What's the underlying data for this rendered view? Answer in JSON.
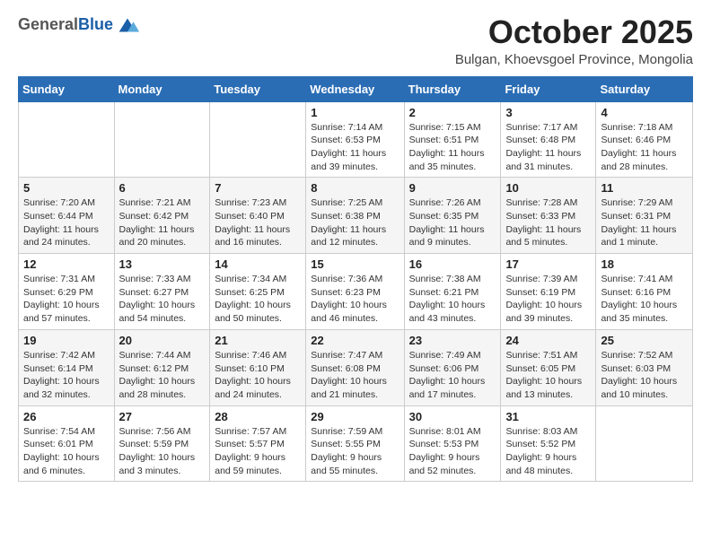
{
  "header": {
    "logo_general": "General",
    "logo_blue": "Blue",
    "month": "October 2025",
    "location": "Bulgan, Khoevsgoel Province, Mongolia"
  },
  "weekdays": [
    "Sunday",
    "Monday",
    "Tuesday",
    "Wednesday",
    "Thursday",
    "Friday",
    "Saturday"
  ],
  "weeks": [
    [
      {
        "day": "",
        "info": ""
      },
      {
        "day": "",
        "info": ""
      },
      {
        "day": "",
        "info": ""
      },
      {
        "day": "1",
        "info": "Sunrise: 7:14 AM\nSunset: 6:53 PM\nDaylight: 11 hours and 39 minutes."
      },
      {
        "day": "2",
        "info": "Sunrise: 7:15 AM\nSunset: 6:51 PM\nDaylight: 11 hours and 35 minutes."
      },
      {
        "day": "3",
        "info": "Sunrise: 7:17 AM\nSunset: 6:48 PM\nDaylight: 11 hours and 31 minutes."
      },
      {
        "day": "4",
        "info": "Sunrise: 7:18 AM\nSunset: 6:46 PM\nDaylight: 11 hours and 28 minutes."
      }
    ],
    [
      {
        "day": "5",
        "info": "Sunrise: 7:20 AM\nSunset: 6:44 PM\nDaylight: 11 hours and 24 minutes."
      },
      {
        "day": "6",
        "info": "Sunrise: 7:21 AM\nSunset: 6:42 PM\nDaylight: 11 hours and 20 minutes."
      },
      {
        "day": "7",
        "info": "Sunrise: 7:23 AM\nSunset: 6:40 PM\nDaylight: 11 hours and 16 minutes."
      },
      {
        "day": "8",
        "info": "Sunrise: 7:25 AM\nSunset: 6:38 PM\nDaylight: 11 hours and 12 minutes."
      },
      {
        "day": "9",
        "info": "Sunrise: 7:26 AM\nSunset: 6:35 PM\nDaylight: 11 hours and 9 minutes."
      },
      {
        "day": "10",
        "info": "Sunrise: 7:28 AM\nSunset: 6:33 PM\nDaylight: 11 hours and 5 minutes."
      },
      {
        "day": "11",
        "info": "Sunrise: 7:29 AM\nSunset: 6:31 PM\nDaylight: 11 hours and 1 minute."
      }
    ],
    [
      {
        "day": "12",
        "info": "Sunrise: 7:31 AM\nSunset: 6:29 PM\nDaylight: 10 hours and 57 minutes."
      },
      {
        "day": "13",
        "info": "Sunrise: 7:33 AM\nSunset: 6:27 PM\nDaylight: 10 hours and 54 minutes."
      },
      {
        "day": "14",
        "info": "Sunrise: 7:34 AM\nSunset: 6:25 PM\nDaylight: 10 hours and 50 minutes."
      },
      {
        "day": "15",
        "info": "Sunrise: 7:36 AM\nSunset: 6:23 PM\nDaylight: 10 hours and 46 minutes."
      },
      {
        "day": "16",
        "info": "Sunrise: 7:38 AM\nSunset: 6:21 PM\nDaylight: 10 hours and 43 minutes."
      },
      {
        "day": "17",
        "info": "Sunrise: 7:39 AM\nSunset: 6:19 PM\nDaylight: 10 hours and 39 minutes."
      },
      {
        "day": "18",
        "info": "Sunrise: 7:41 AM\nSunset: 6:16 PM\nDaylight: 10 hours and 35 minutes."
      }
    ],
    [
      {
        "day": "19",
        "info": "Sunrise: 7:42 AM\nSunset: 6:14 PM\nDaylight: 10 hours and 32 minutes."
      },
      {
        "day": "20",
        "info": "Sunrise: 7:44 AM\nSunset: 6:12 PM\nDaylight: 10 hours and 28 minutes."
      },
      {
        "day": "21",
        "info": "Sunrise: 7:46 AM\nSunset: 6:10 PM\nDaylight: 10 hours and 24 minutes."
      },
      {
        "day": "22",
        "info": "Sunrise: 7:47 AM\nSunset: 6:08 PM\nDaylight: 10 hours and 21 minutes."
      },
      {
        "day": "23",
        "info": "Sunrise: 7:49 AM\nSunset: 6:06 PM\nDaylight: 10 hours and 17 minutes."
      },
      {
        "day": "24",
        "info": "Sunrise: 7:51 AM\nSunset: 6:05 PM\nDaylight: 10 hours and 13 minutes."
      },
      {
        "day": "25",
        "info": "Sunrise: 7:52 AM\nSunset: 6:03 PM\nDaylight: 10 hours and 10 minutes."
      }
    ],
    [
      {
        "day": "26",
        "info": "Sunrise: 7:54 AM\nSunset: 6:01 PM\nDaylight: 10 hours and 6 minutes."
      },
      {
        "day": "27",
        "info": "Sunrise: 7:56 AM\nSunset: 5:59 PM\nDaylight: 10 hours and 3 minutes."
      },
      {
        "day": "28",
        "info": "Sunrise: 7:57 AM\nSunset: 5:57 PM\nDaylight: 9 hours and 59 minutes."
      },
      {
        "day": "29",
        "info": "Sunrise: 7:59 AM\nSunset: 5:55 PM\nDaylight: 9 hours and 55 minutes."
      },
      {
        "day": "30",
        "info": "Sunrise: 8:01 AM\nSunset: 5:53 PM\nDaylight: 9 hours and 52 minutes."
      },
      {
        "day": "31",
        "info": "Sunrise: 8:03 AM\nSunset: 5:52 PM\nDaylight: 9 hours and 48 minutes."
      },
      {
        "day": "",
        "info": ""
      }
    ]
  ]
}
